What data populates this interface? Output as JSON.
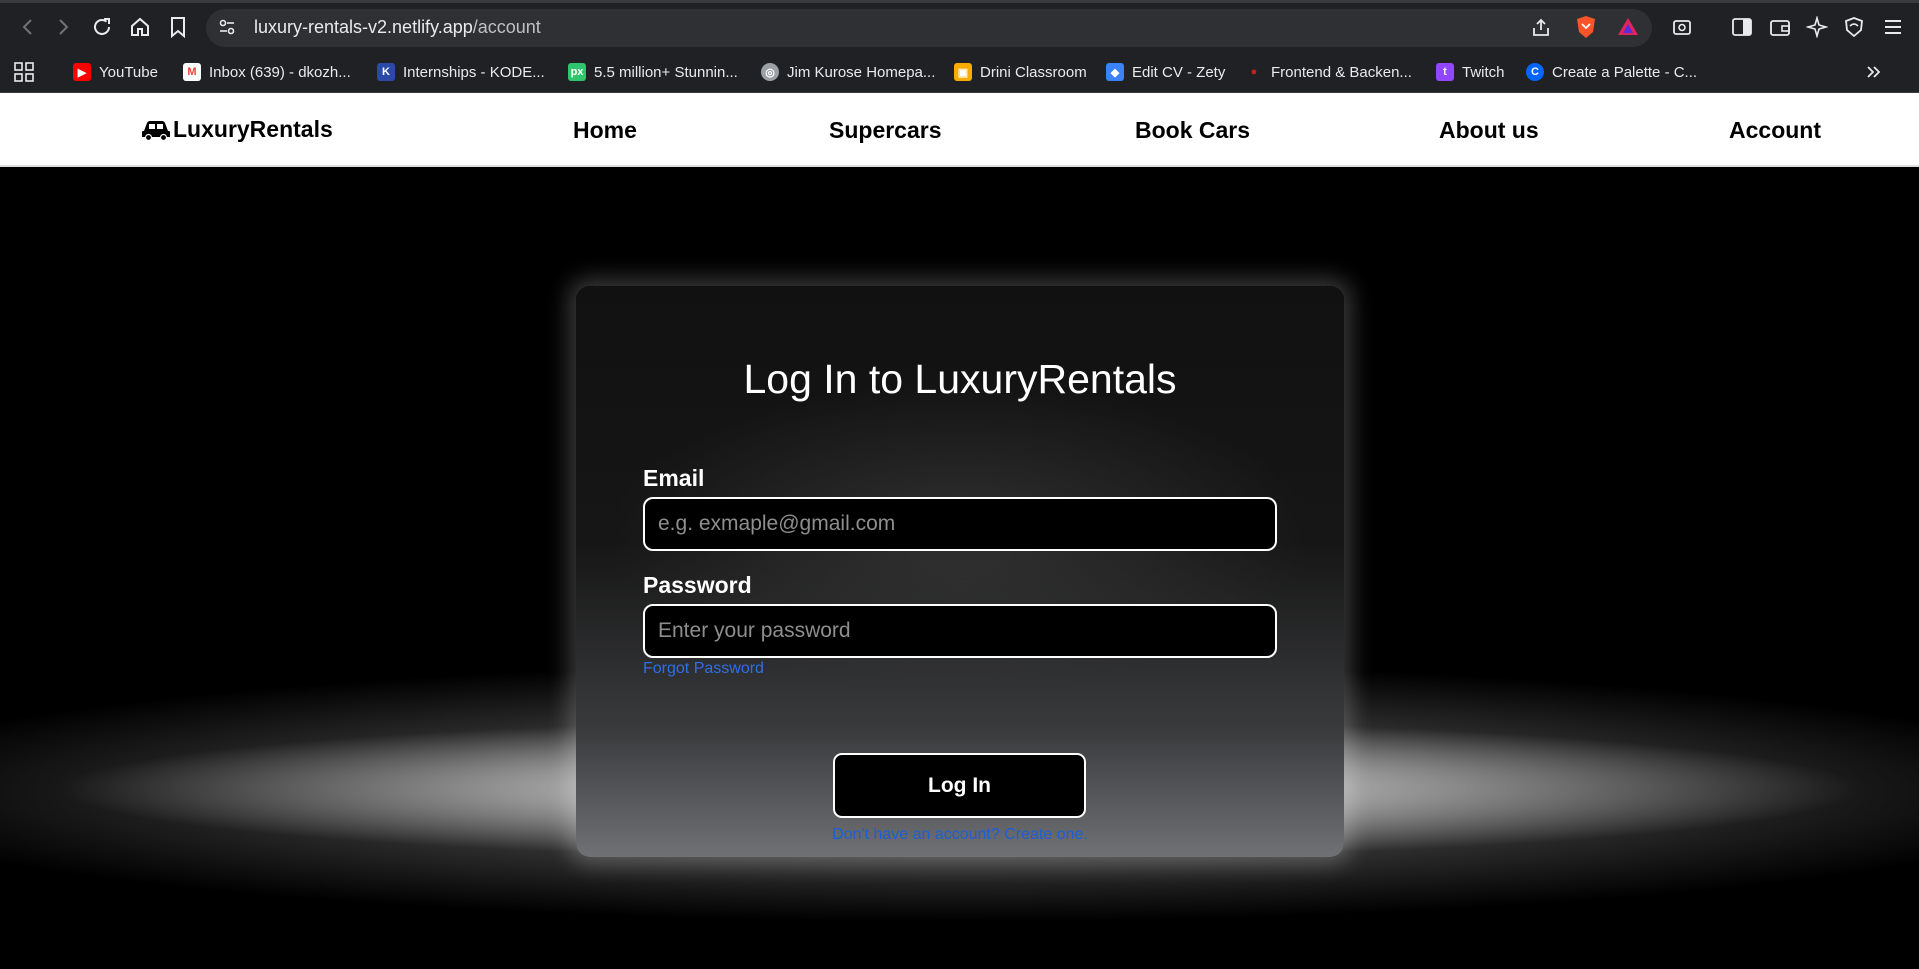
{
  "browser": {
    "url_host": "luxury-rentals-v2.netlify.app",
    "url_path": "/account",
    "bookmarks": [
      {
        "label": "YouTube",
        "icon": "youtube-icon",
        "color": "#ff0000"
      },
      {
        "label": "Inbox (639) - dkozh...",
        "icon": "gmail-icon",
        "color": "#ea4335"
      },
      {
        "label": "Internships - KODE...",
        "icon": "kode-icon",
        "color": "#2b4aa8"
      },
      {
        "label": "5.5 million+ Stunnin...",
        "icon": "pixabay-icon",
        "color": "#2ec66d"
      },
      {
        "label": "Jim Kurose Homepa...",
        "icon": "globe-icon",
        "color": "#9aa0a6"
      },
      {
        "label": "Drini Classroom",
        "icon": "classroom-icon",
        "color": "#f9ab00"
      },
      {
        "label": "Edit CV - Zety",
        "icon": "zety-icon",
        "color": "#3b82f6"
      },
      {
        "label": "Frontend & Backen...",
        "icon": "dot-icon",
        "color": "#c5221f"
      },
      {
        "label": "Twitch",
        "icon": "twitch-icon",
        "color": "#9146ff"
      },
      {
        "label": "Create a Palette - C...",
        "icon": "coolors-icon",
        "color": "#0066ff"
      }
    ]
  },
  "nav": {
    "brand": "LuxuryRentals",
    "links": [
      "Home",
      "Supercars",
      "Book Cars",
      "About us",
      "Account"
    ]
  },
  "login": {
    "title": "Log In to LuxuryRentals",
    "email_label": "Email",
    "email_placeholder": "e.g. exmaple@gmail.com",
    "password_label": "Password",
    "password_placeholder": "Enter your password",
    "forgot": "Forgot Password",
    "button": "Log In",
    "signup": "Don't have an account? Create one."
  },
  "colors": {
    "link": "#2f6fe8",
    "card_border": "#ffffff"
  }
}
